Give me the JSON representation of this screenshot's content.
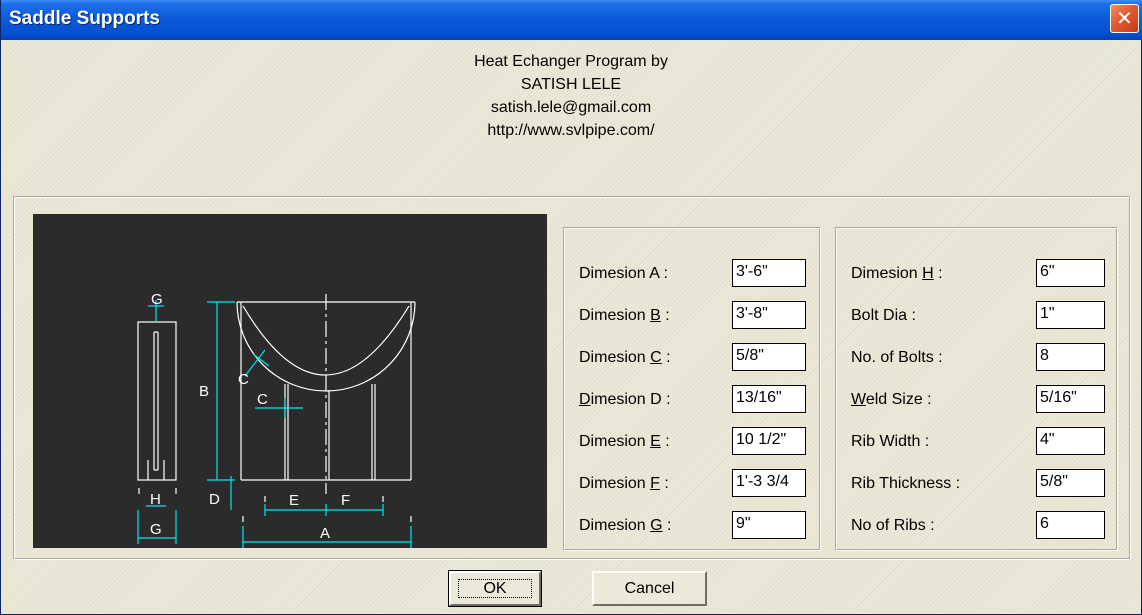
{
  "window": {
    "title": "Saddle Supports",
    "close_glyph": "✕"
  },
  "header": {
    "line1": "Heat Echanger Program by",
    "line2": "SATISH LELE",
    "line3": "satish.lele@gmail.com",
    "line4": "http://www.svlpipe.com/"
  },
  "drawing": {
    "labels": {
      "a": "A",
      "b": "B",
      "c": "C",
      "c2": "C",
      "d": "D",
      "e": "E",
      "f": "F",
      "g": "G",
      "g2": "G",
      "h": "H"
    }
  },
  "left_panel": {
    "rows": [
      {
        "label_pre": "Dimesion A :",
        "label_ul": "",
        "label_post": "",
        "value": "3'-6\""
      },
      {
        "label_pre": "Dimesion ",
        "label_ul": "B",
        "label_post": " :",
        "value": "3'-8\""
      },
      {
        "label_pre": "Dimesion ",
        "label_ul": "C",
        "label_post": " :",
        "value": "5/8\""
      },
      {
        "label_pre": "",
        "label_ul": "D",
        "label_post": "imesion D :",
        "value": "13/16\""
      },
      {
        "label_pre": "Dimesion ",
        "label_ul": "E",
        "label_post": " :",
        "value": "10 1/2\""
      },
      {
        "label_pre": "Dimesion ",
        "label_ul": "F",
        "label_post": " :",
        "value": "1'-3 3/4"
      },
      {
        "label_pre": "Dimesion ",
        "label_ul": "G",
        "label_post": " :",
        "value": "9\""
      }
    ]
  },
  "right_panel": {
    "rows": [
      {
        "label_pre": "Dimesion ",
        "label_ul": "H",
        "label_post": " :",
        "value": "6\""
      },
      {
        "label_pre": "Bolt Dia :",
        "label_ul": "",
        "label_post": "",
        "value": "1\""
      },
      {
        "label_pre": "No. of Bolts :",
        "label_ul": "",
        "label_post": "",
        "value": "8"
      },
      {
        "label_pre": "",
        "label_ul": "W",
        "label_post": "eld Size :",
        "value": "5/16\""
      },
      {
        "label_pre": "Rib Width :",
        "label_ul": "",
        "label_post": "",
        "value": "4\""
      },
      {
        "label_pre": "Rib Thickness :",
        "label_ul": "",
        "label_post": "",
        "value": "5/8\""
      },
      {
        "label_pre": "No of Ribs :",
        "label_ul": "",
        "label_post": "",
        "value": "6"
      }
    ]
  },
  "buttons": {
    "ok_label": "OK",
    "cancel_label": "Cancel"
  },
  "colors": {
    "drawing_bg": "#2b2b2b",
    "drawing_lines": "#ffffff",
    "dimension_lines": "#00e5ee",
    "title_bar": "#0a5ad8",
    "dialog_bg": "#ece9d8"
  }
}
